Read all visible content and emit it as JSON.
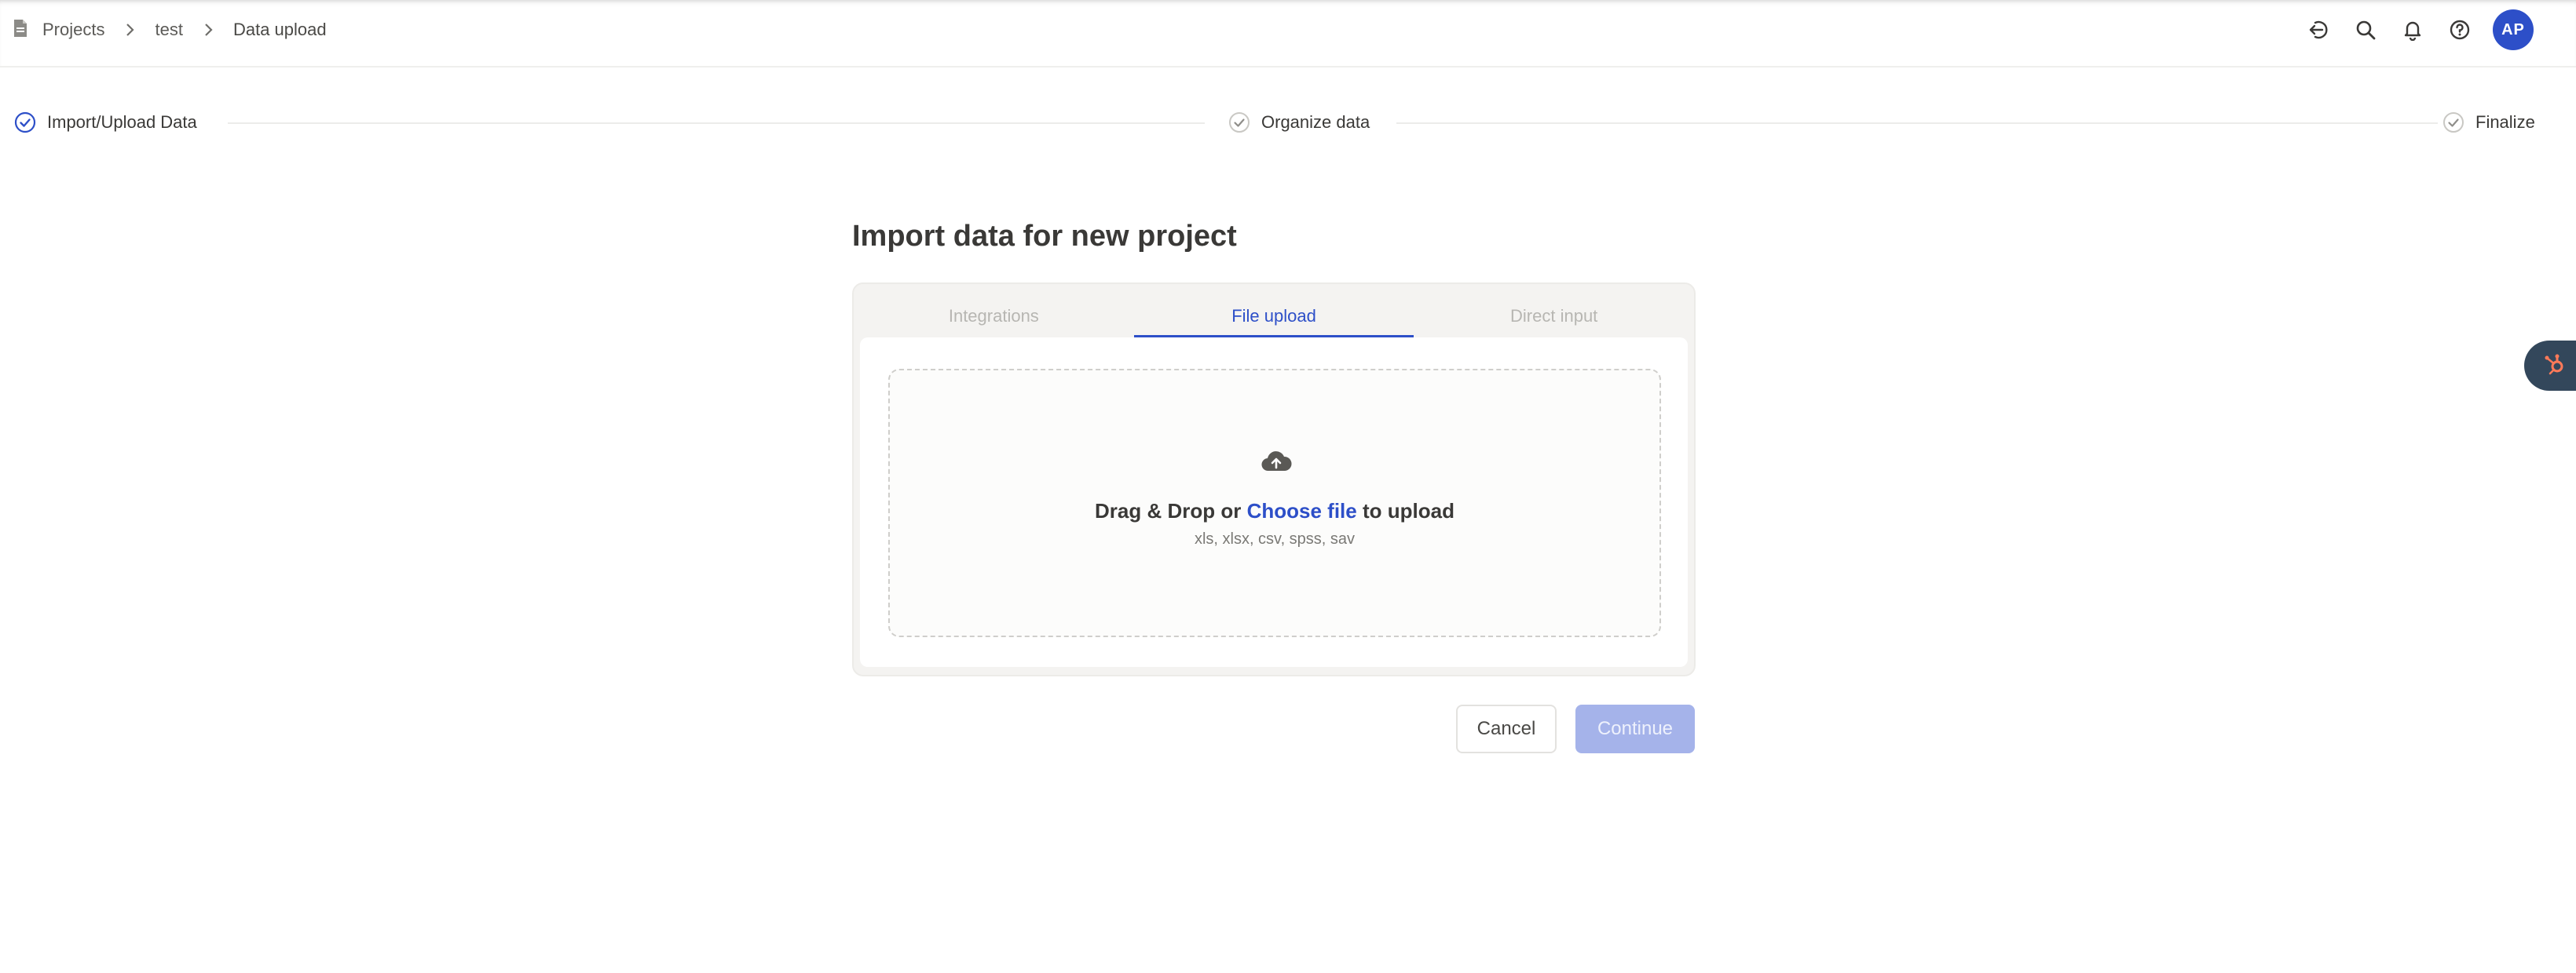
{
  "breadcrumb": {
    "items": [
      "Projects",
      "test",
      "Data upload"
    ]
  },
  "header": {
    "actions": [
      {
        "icon": "collapse-left-icon"
      },
      {
        "icon": "search-icon"
      },
      {
        "icon": "bell-icon"
      },
      {
        "icon": "help-icon"
      }
    ],
    "avatar_initials": "AP"
  },
  "stepper": {
    "steps": [
      {
        "label": "Import/Upload Data",
        "status": "active"
      },
      {
        "label": "Organize data",
        "status": "pending"
      },
      {
        "label": "Finalize",
        "status": "pending"
      }
    ]
  },
  "main": {
    "title": "Import data for new project",
    "tabs": [
      {
        "label": "Integrations",
        "active": false
      },
      {
        "label": "File upload",
        "active": true
      },
      {
        "label": "Direct input",
        "active": false
      }
    ],
    "dropzone": {
      "icon": "cloud-upload-icon",
      "text_before": "Drag & Drop or ",
      "link_text": "Choose file",
      "text_after": " to upload",
      "formats": "xls, xlsx, csv, spss, sav"
    },
    "buttons": {
      "cancel": "Cancel",
      "continue": "Continue"
    }
  },
  "colors": {
    "accent": "#2d4fc8",
    "accent_disabled": "#a5b3ea",
    "hubspot_bg": "#33475b",
    "hubspot_orange": "#ff7a59"
  },
  "widget": {
    "icon": "hubspot-icon"
  }
}
